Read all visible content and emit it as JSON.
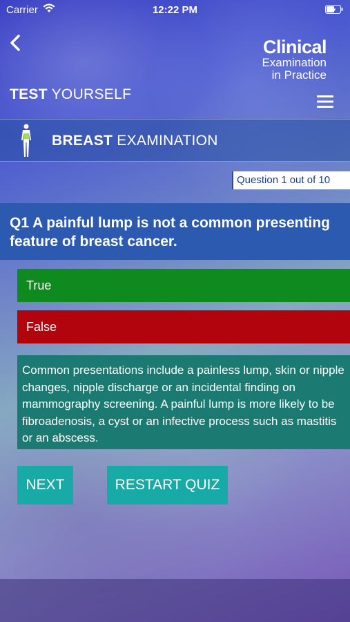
{
  "status_bar": {
    "carrier": "Carrier",
    "time": "12:22 PM",
    "icons": [
      "wifi-icon",
      "battery-icon"
    ]
  },
  "header": {
    "back_icon": "chevron-left-icon",
    "logo": {
      "title": "Clinical",
      "subtitle_line1": "Examination",
      "subtitle_line2": "in Practice"
    },
    "section": {
      "bold": "TEST",
      "normal": " YOURSELF"
    },
    "menu_icon": "hamburger-menu-icon"
  },
  "exam": {
    "icon": "body-figure-icon",
    "title_bold": "BREAST",
    "title_normal": " EXAMINATION"
  },
  "quiz": {
    "counter": "Question 1 out of 10",
    "question": "Q1 A painful lump is not a common presenting feature of breast cancer.",
    "answers": [
      {
        "label": "True",
        "status": "correct",
        "color": "#0e8a1e"
      },
      {
        "label": "False",
        "status": "incorrect",
        "color": "#b2040c"
      }
    ],
    "explanation": "Common presentations include a painless lump, skin or nipple changes, nipple discharge or an incidental finding on mammography screening. A painful lump is more likely to be fibroadenosis, a cyst or an infective process such as mastitis or an abscess."
  },
  "buttons": {
    "next": "NEXT",
    "restart": "RESTART QUIZ"
  },
  "colors": {
    "question_bg": "#2c5ab0",
    "explanation_bg": "#1b7a72",
    "button_bg": "#17aaa6"
  }
}
